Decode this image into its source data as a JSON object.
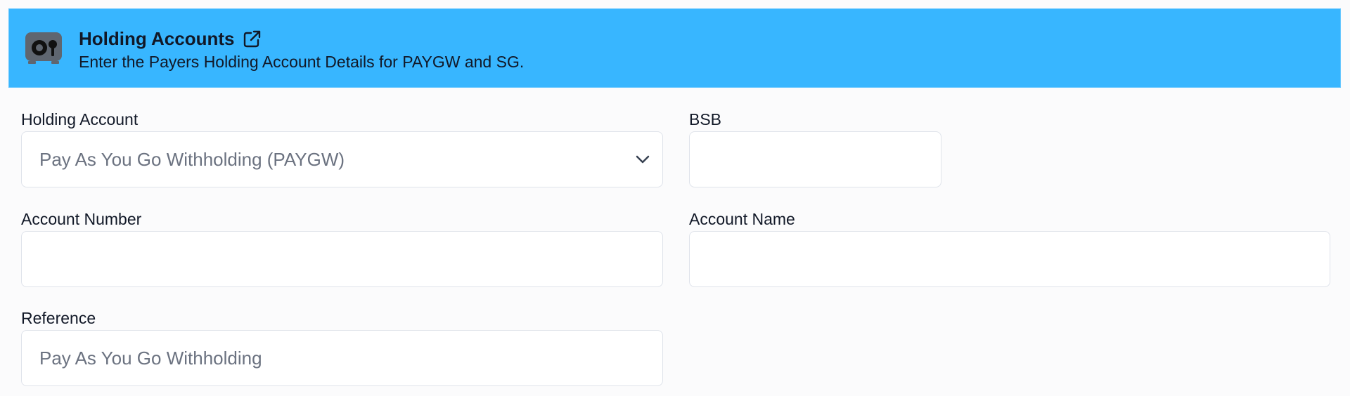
{
  "section": {
    "title": "Holding Accounts",
    "subtitle": "Enter the Payers Holding Account Details for PAYGW and SG.",
    "icon": "safe-icon",
    "link_icon": "external-link-icon",
    "banner_color": "#38b6ff"
  },
  "fields": {
    "holding_account": {
      "label": "Holding Account",
      "value": "Pay As You Go Withholding (PAYGW)"
    },
    "bsb": {
      "label": "BSB",
      "value": ""
    },
    "account_number": {
      "label": "Account Number",
      "value": ""
    },
    "account_name": {
      "label": "Account Name",
      "value": ""
    },
    "reference": {
      "label": "Reference",
      "value": "Pay As You Go Withholding"
    }
  }
}
